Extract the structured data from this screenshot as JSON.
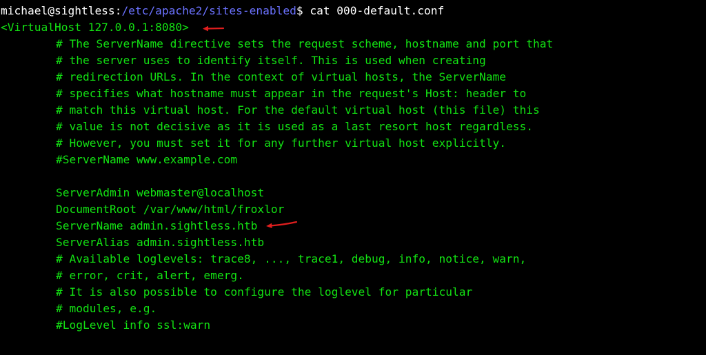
{
  "prompt": {
    "user_host": "michael@sightless",
    "separator": ":",
    "path": "/etc/apache2/sites-enabled",
    "symbol": "$",
    "command": " cat 000-default.conf"
  },
  "lines": [
    "<VirtualHost 127.0.0.1:8080>",
    "# The ServerName directive sets the request scheme, hostname and port that",
    "# the server uses to identify itself. This is used when creating",
    "# redirection URLs. In the context of virtual hosts, the ServerName",
    "# specifies what hostname must appear in the request's Host: header to",
    "# match this virtual host. For the default virtual host (this file) this",
    "# value is not decisive as it is used as a last resort host regardless.",
    "# However, you must set it for any further virtual host explicitly.",
    "#ServerName www.example.com",
    "",
    "ServerAdmin webmaster@localhost",
    "DocumentRoot /var/www/html/froxlor",
    "ServerName admin.sightless.htb",
    "ServerAlias admin.sightless.htb",
    "# Available loglevels: trace8, ..., trace1, debug, info, notice, warn,",
    "# error, crit, alert, emerg.",
    "# It is also possible to configure the loglevel for particular",
    "# modules, e.g.",
    "#LogLevel info ssl:warn",
    ""
  ],
  "colors": {
    "background": "#000000",
    "text_green": "#13e213",
    "prompt_white": "#ffffff",
    "path_blue": "#6b72ff",
    "annotation_red": "#e01e1e"
  }
}
